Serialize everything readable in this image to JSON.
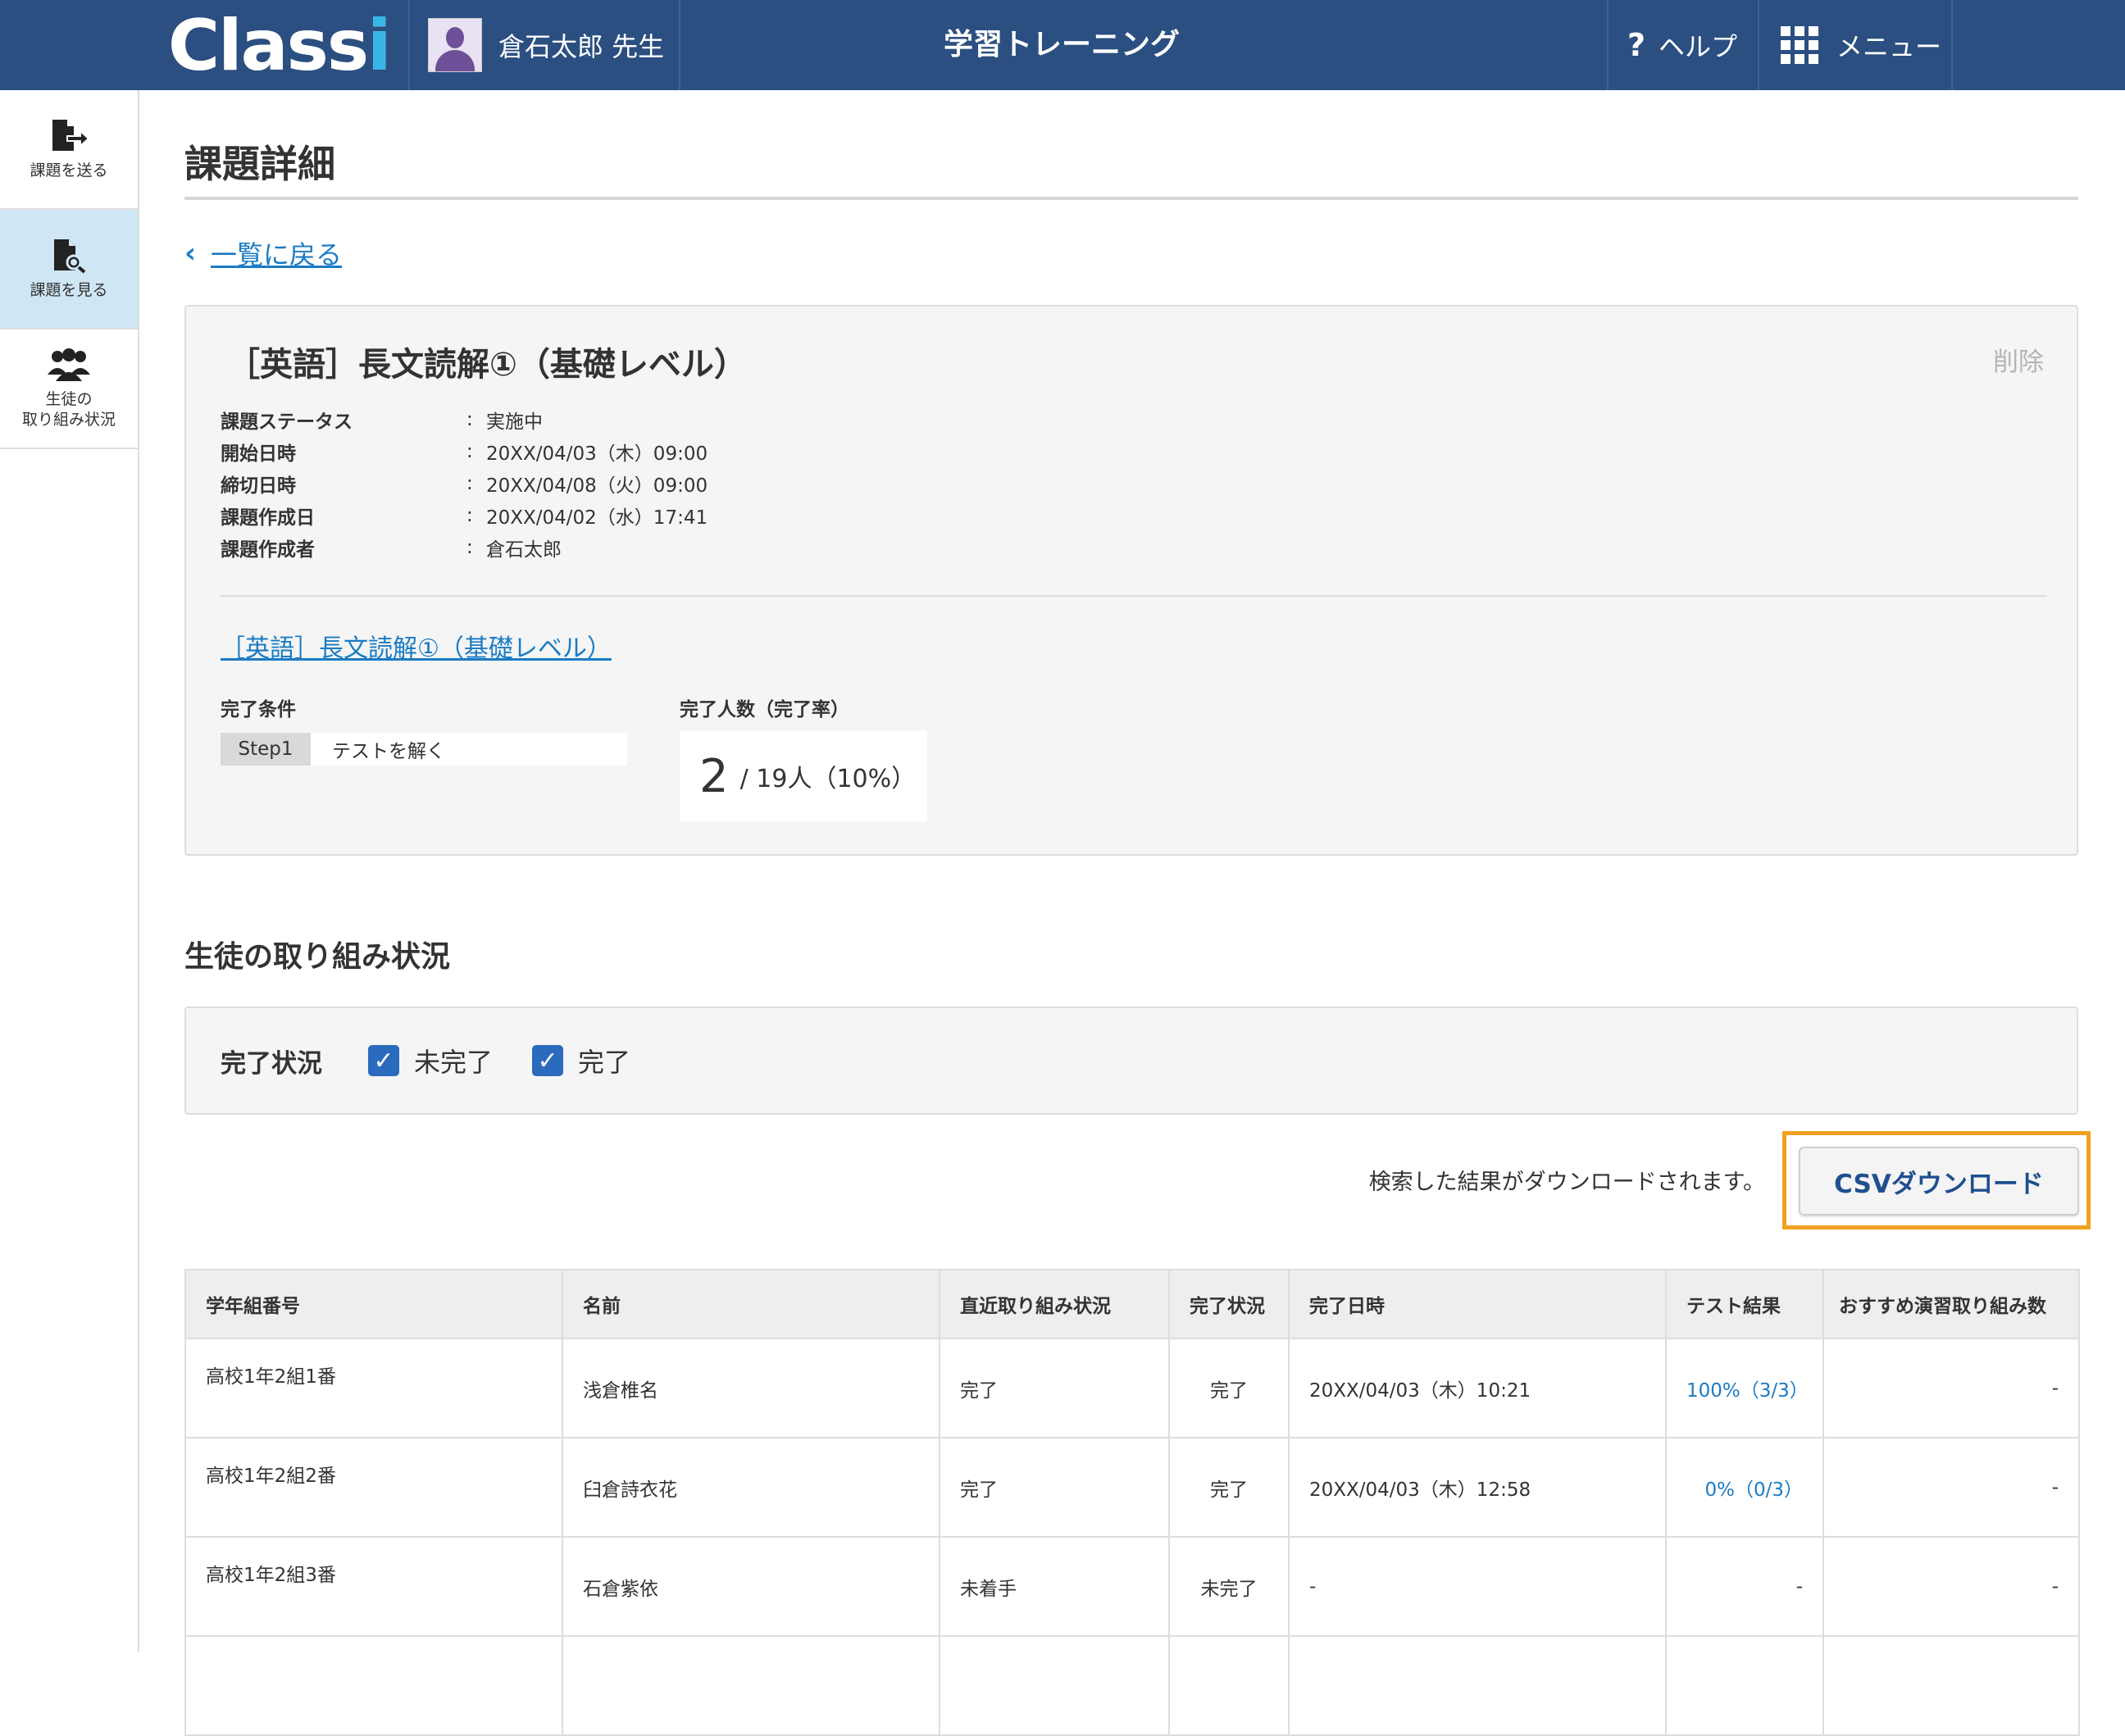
{
  "header": {
    "logo": "Classi",
    "user_name": "倉石太郎 先生",
    "app_title": "学習トレーニング",
    "help_label": "ヘルプ",
    "menu_label": "メニュー"
  },
  "sidebar": {
    "items": [
      {
        "label": "課題を送る",
        "icon": "send-document-icon"
      },
      {
        "label": "課題を見る",
        "icon": "view-document-icon"
      },
      {
        "label": "生徒の\n取り組み状況",
        "icon": "students-icon"
      }
    ]
  },
  "page": {
    "title": "課題詳細",
    "back_link": "一覧に戻る"
  },
  "assignment": {
    "title": "［英語］長文読解①（基礎レベル）",
    "delete_label": "削除",
    "meta": [
      {
        "label": "課題ステータス",
        "value": "実施中"
      },
      {
        "label": "開始日時",
        "value": "20XX/04/03（木）09:00"
      },
      {
        "label": "締切日時",
        "value": "20XX/04/08（火）09:00"
      },
      {
        "label": "課題作成日",
        "value": "20XX/04/02（水）17:41"
      },
      {
        "label": "課題作成者",
        "value": "倉石太郎"
      }
    ],
    "content_link": "［英語］長文読解①（基礎レベル）",
    "condition_label": "完了条件",
    "step_badge": "Step1",
    "step_text": "テストを解く",
    "count_label": "完了人数（完了率）",
    "count_done": "2",
    "count_rest": "/ 19人（10%）"
  },
  "progress": {
    "section_title": "生徒の取り組み状況",
    "filter_label": "完了状況",
    "filters": [
      {
        "label": "未完了",
        "checked": true
      },
      {
        "label": "完了",
        "checked": true
      }
    ],
    "download_note": "検索した結果がダウンロードされます。",
    "download_button": "CSVダウンロード"
  },
  "table": {
    "headers": [
      "学年組番号",
      "名前",
      "直近取り組み状況",
      "完了状況",
      "完了日時",
      "テスト結果",
      "おすすめ演習取り組み数"
    ],
    "rows": [
      {
        "class_no": "高校1年2組1番",
        "name": "浅倉椎名",
        "recent": "完了",
        "status": "完了",
        "date": "20XX/04/03（木）10:21",
        "result": "100%（3/3）",
        "practice": "-"
      },
      {
        "class_no": "高校1年2組2番",
        "name": "臼倉詩衣花",
        "recent": "完了",
        "status": "完了",
        "date": "20XX/04/03（木）12:58",
        "result": "0%（0/3）",
        "practice": "-"
      },
      {
        "class_no": "高校1年2組3番",
        "name": "石倉紫依",
        "recent": "未着手",
        "status": "未完了",
        "date": "-",
        "result": "-",
        "practice": "-"
      }
    ]
  },
  "colors": {
    "header_bg": "#2b4f80",
    "link": "#1a7bc4",
    "active_sidebar": "#cfe6f4",
    "highlight_outline": "#f0a020",
    "checkbox": "#2b6bbd"
  }
}
